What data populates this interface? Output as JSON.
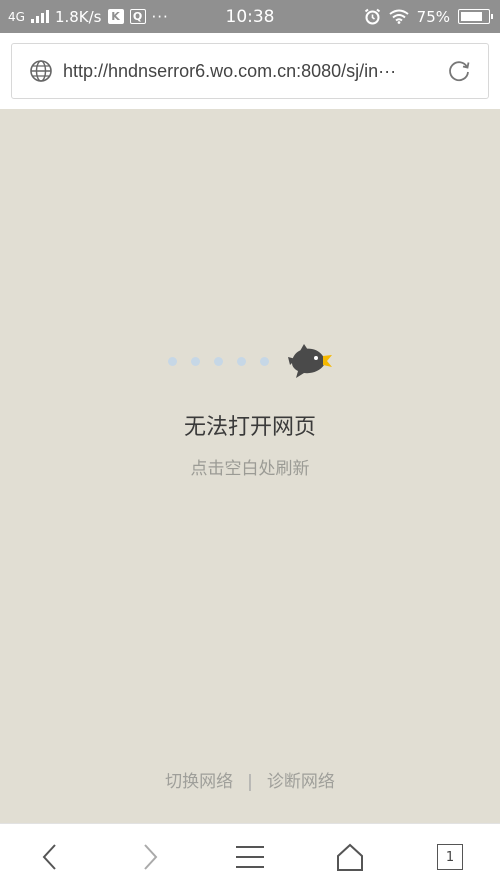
{
  "status_bar": {
    "network": "4G",
    "speed": "1.8K/s",
    "badge_k": "K",
    "badge_q": "Q",
    "dots": "···",
    "time": "10:38",
    "battery": "75%"
  },
  "address_bar": {
    "url": "http://hndnserror6.wo.com.cn:8080/sj/in···"
  },
  "error_page": {
    "title": "无法打开网页",
    "subtitle": "点击空白处刷新",
    "switch_network": "切换网络",
    "separator": "|",
    "diagnose_network": "诊断网络"
  },
  "toolbar": {
    "tab_count": "1"
  },
  "colors": {
    "page_bg": "#e1ded3",
    "status_bg": "#909090",
    "bird_body": "#4a4a4a",
    "bird_beak": "#f5b800",
    "dots": "#c6d7e6"
  },
  "icons": [
    "globe-icon",
    "refresh-icon",
    "back-icon",
    "forward-icon",
    "menu-icon",
    "home-icon",
    "tabs-icon",
    "bird-icon"
  ]
}
